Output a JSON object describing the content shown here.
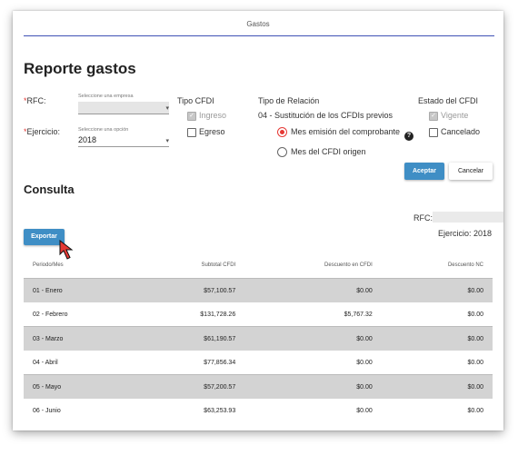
{
  "header": {
    "title": "Gastos"
  },
  "page": {
    "title": "Reporte gastos"
  },
  "filters": {
    "rfc": {
      "required_mark": "*",
      "label": "RFC:",
      "caption": "Seleccione una empresa",
      "value": ""
    },
    "ejercicio": {
      "required_mark": "*",
      "label": "Ejercicio:",
      "caption": "Seleccione una opción",
      "value": "2018"
    },
    "tipo_cfdi": {
      "heading": "Tipo CFDI",
      "options": [
        {
          "label": "Ingreso",
          "checked": true,
          "disabled": true
        },
        {
          "label": "Egreso",
          "checked": false,
          "disabled": false
        }
      ]
    },
    "tipo_relacion": {
      "heading": "Tipo de Relación",
      "value": "04 - Sustitución de los CFDIs previos",
      "options": [
        {
          "label": "Mes emisión del comprobante",
          "selected": true
        },
        {
          "label": "Mes del CFDI origen",
          "selected": false
        }
      ]
    },
    "estado_cfdi": {
      "heading": "Estado del CFDI",
      "options": [
        {
          "label": "Vigente",
          "checked": true,
          "disabled": true
        },
        {
          "label": "Cancelado",
          "checked": false,
          "disabled": false
        }
      ]
    }
  },
  "actions": {
    "accept_label": "Aceptar",
    "cancel_label": "Cancelar"
  },
  "consulta": {
    "title": "Consulta",
    "rfc_label": "RFC:",
    "rfc_value": "",
    "ejercicio_label": "Ejercicio: 2018",
    "export_label": "Exportar"
  },
  "table": {
    "columns": [
      "Periodo/Mes",
      "Subtotal CFDI",
      "Descuento en CFDI",
      "Descuento NC"
    ],
    "rows": [
      [
        "01 - Enero",
        "$57,100.57",
        "$0.00",
        "$0.00"
      ],
      [
        "02 - Febrero",
        "$131,728.26",
        "$5,767.32",
        "$0.00"
      ],
      [
        "03 - Marzo",
        "$61,190.57",
        "$0.00",
        "$0.00"
      ],
      [
        "04 - Abril",
        "$77,856.34",
        "$0.00",
        "$0.00"
      ],
      [
        "05 - Mayo",
        "$57,200.57",
        "$0.00",
        "$0.00"
      ],
      [
        "06 - Junio",
        "$63,253.93",
        "$0.00",
        "$0.00"
      ]
    ]
  },
  "colors": {
    "accent": "#3f8ec5",
    "required": "#e53935",
    "header_line": "#3f51b5",
    "row_shade": "#d3d3d3",
    "cursor": "#e53935"
  },
  "icons": {
    "help": "question-circle-icon",
    "cursor": "mouse-pointer-icon",
    "dropdown": "caret-down-icon"
  }
}
